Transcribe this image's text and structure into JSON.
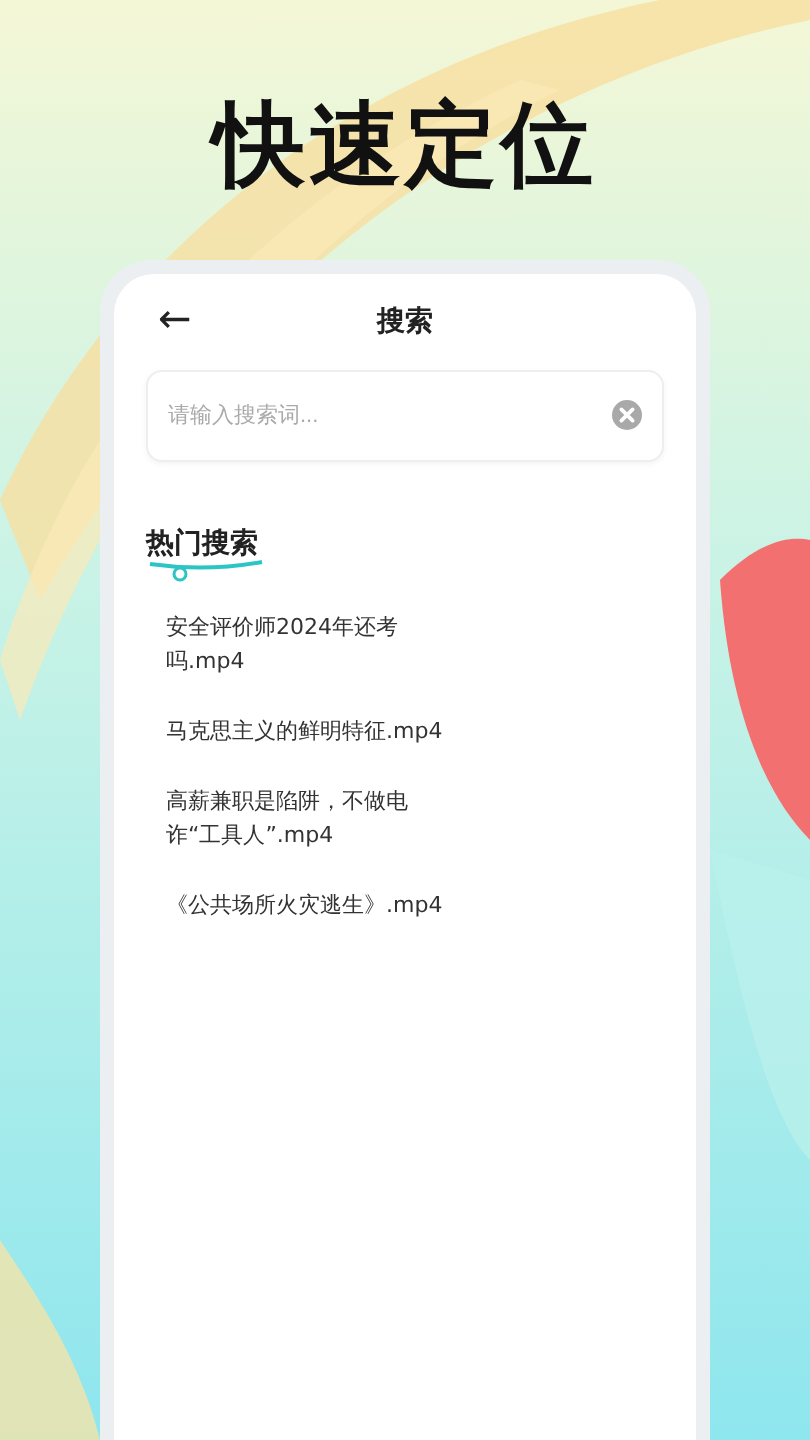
{
  "headline": "快速定位",
  "screen": {
    "title": "搜索",
    "back": "←",
    "search": {
      "placeholder": "请输入搜索词..."
    },
    "hot_section": {
      "title": "热门搜索",
      "items": [
        "安全评价师2024年还考吗.mp4",
        "马克思主义的鲜明特征.mp4",
        "高薪兼职是陷阱，不做电诈“工具人”.mp4",
        "《公共场所火灾逃生》.mp4"
      ]
    }
  }
}
